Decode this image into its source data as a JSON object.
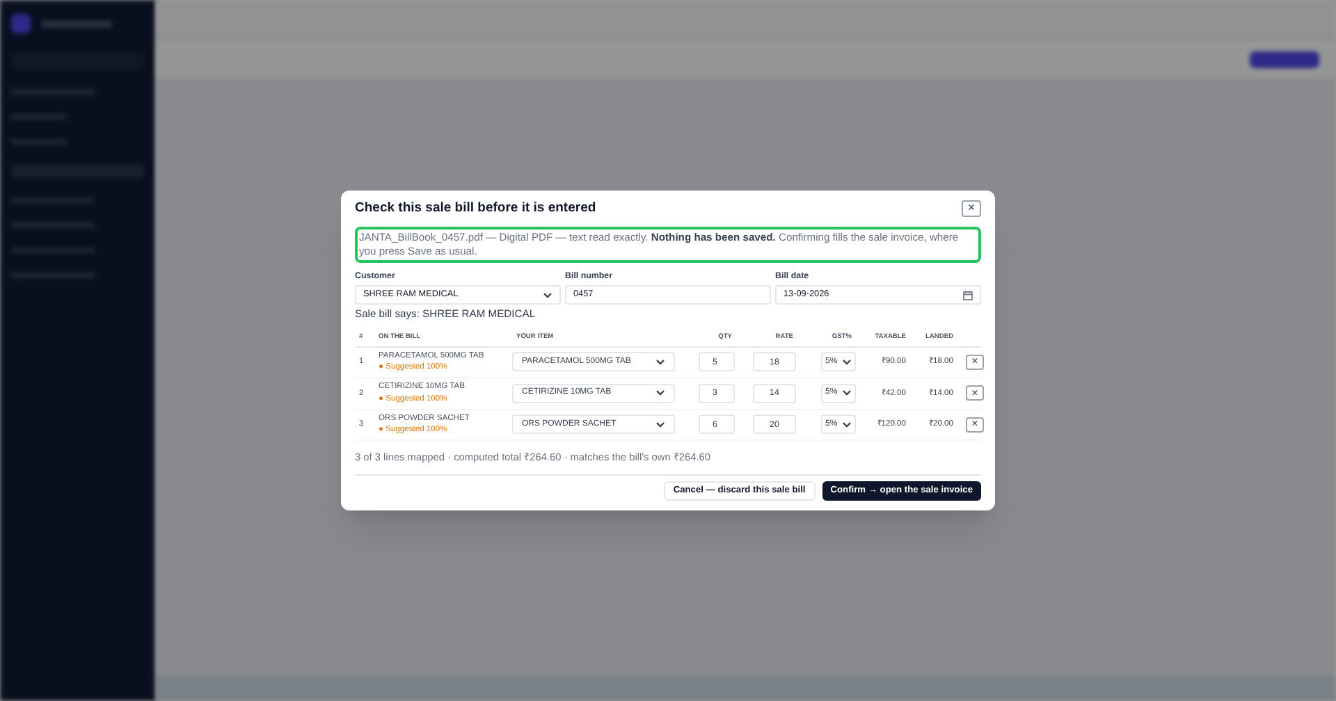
{
  "modal": {
    "title": "Check this sale bill before it is entered",
    "close": "×",
    "notice": "JANTA_BillBook_0457.pdf — Digital PDF — text read exactly. **Nothing has been saved.** Confirming fills the sale invoice, where you press Save as usual.",
    "fields": [
      {
        "label": "Customer",
        "kind": "select",
        "value": "SHREE RAM MEDICAL"
      },
      {
        "label": "Bill number",
        "kind": "text",
        "value": "0457"
      },
      {
        "label": "Bill date",
        "kind": "date",
        "value": "13-09-2026"
      }
    ],
    "bill_says": "Sale bill says: SHREE RAM MEDICAL",
    "table": {
      "columns": [
        "#",
        "ON THE BILL",
        "YOUR ITEM",
        "QTY",
        "RATE",
        "GST%",
        "TAXABLE",
        "LANDED"
      ],
      "rows": [
        {
          "number": "1",
          "bill_item": "PARACETAMOL 500MG TAB",
          "suggestion": "● Suggested 100%",
          "your_item": "PARACETAMOL 500MG TAB",
          "qty": "5",
          "rate": "18",
          "gst": "5%",
          "taxable": "₹90.00",
          "landed": "₹18.00",
          "remove": "×"
        },
        {
          "number": "2",
          "bill_item": "CETIRIZINE 10MG TAB",
          "suggestion": "● Suggested 100%",
          "your_item": "CETIRIZINE 10MG TAB",
          "qty": "3",
          "rate": "14",
          "gst": "5%",
          "taxable": "₹42.00",
          "landed": "₹14.00",
          "remove": "×"
        },
        {
          "number": "3",
          "bill_item": "ORS POWDER SACHET",
          "suggestion": "● Suggested 100%",
          "your_item": "ORS POWDER SACHET",
          "qty": "6",
          "rate": "20",
          "gst": "5%",
          "taxable": "₹120.00",
          "landed": "₹20.00",
          "remove": "×"
        }
      ]
    },
    "summary": "3 of 3 lines mapped · computed total ₹264.60 · matches the bill's own ₹264.60",
    "buttons": [
      {
        "label": "Cancel — discard this sale bill",
        "kind": "secondary"
      },
      {
        "label": "Confirm → open the sale invoice",
        "kind": "primary"
      }
    ]
  }
}
